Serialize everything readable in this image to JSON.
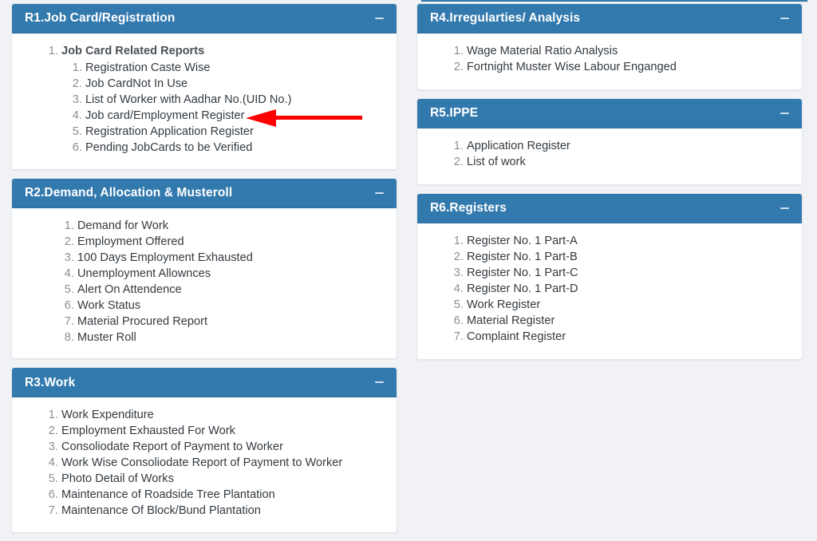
{
  "page": {
    "background_color": "#f0f2f5",
    "panel_header_color": "#3279ae",
    "panel_body_color": "#ffffff",
    "annotation_color": "#ff0000"
  },
  "columns": [
    {
      "panels": [
        {
          "id": "r1",
          "title": "R1.Job Card/Registration",
          "collapse_icon": "minus-icon",
          "list_style": "nested",
          "items": [
            {
              "label": "Job Card Related Reports",
              "bold": true,
              "children": [
                "Registration Caste Wise",
                "Job CardNot In Use",
                "List of Worker with Aadhar No.(UID No.)",
                "Job card/Employment Register",
                "Registration Application Register",
                "Pending JobCards to be Verified"
              ]
            }
          ]
        },
        {
          "id": "r2",
          "title": "R2.Demand, Allocation & Musteroll",
          "collapse_icon": "minus-icon",
          "list_style": "deep",
          "items": [
            {
              "label": "Demand for Work"
            },
            {
              "label": "Employment Offered"
            },
            {
              "label": "100 Days Employment Exhausted"
            },
            {
              "label": "Unemployment Allownces"
            },
            {
              "label": "Alert On Attendence"
            },
            {
              "label": "Work Status"
            },
            {
              "label": "Material Procured Report"
            },
            {
              "label": "Muster Roll"
            }
          ]
        },
        {
          "id": "r3",
          "title": "R3.Work",
          "collapse_icon": "minus-icon",
          "list_style": "normal",
          "items": [
            {
              "label": "Work Expenditure"
            },
            {
              "label": "Employment Exhausted For Work"
            },
            {
              "label": "Consoliodate Report of Payment to Worker"
            },
            {
              "label": "Work Wise Consoliodate Report of Payment to Worker"
            },
            {
              "label": "Photo Detail of Works"
            },
            {
              "label": "Maintenance of Roadside Tree Plantation"
            },
            {
              "label": "Maintenance Of Block/Bund Plantation"
            }
          ]
        }
      ]
    },
    {
      "panels": [
        {
          "id": "r4",
          "title": "R4.Irregularties/ Analysis",
          "collapse_icon": "minus-icon",
          "list_style": "normal",
          "items": [
            {
              "label": "Wage Material Ratio Analysis"
            },
            {
              "label": "Fortnight Muster Wise Labour Enganged"
            }
          ]
        },
        {
          "id": "r5",
          "title": "R5.IPPE",
          "collapse_icon": "minus-icon",
          "list_style": "normal",
          "items": [
            {
              "label": "Application Register"
            },
            {
              "label": "List of work"
            }
          ]
        },
        {
          "id": "r6",
          "title": "R6.Registers",
          "collapse_icon": "minus-icon",
          "list_style": "normal",
          "items": [
            {
              "label": "Register No. 1 Part-A"
            },
            {
              "label": "Register No. 1 Part-B"
            },
            {
              "label": "Register No. 1 Part-C"
            },
            {
              "label": "Register No. 1 Part-D"
            },
            {
              "label": "Work Register"
            },
            {
              "label": "Material Register"
            },
            {
              "label": "Complaint Register"
            }
          ]
        }
      ]
    }
  ],
  "annotation": {
    "type": "arrow",
    "points_to": "Job card/Employment Register",
    "direction": "left",
    "color": "#ff0000"
  }
}
